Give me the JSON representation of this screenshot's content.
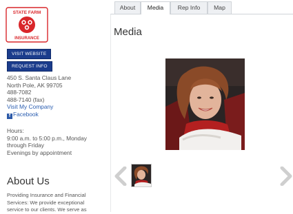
{
  "sidebar": {
    "logo": {
      "top_text": "STATE FARM",
      "bottom_text": "INSURANCE"
    },
    "buttons": {
      "visit_website": "VISIT WEBSITE",
      "request_info": "REQUEST INFO"
    },
    "address_line1": "450 S. Santa Claus Lane",
    "address_line2": "North Pole, AK 99705",
    "phone": "488-7082",
    "fax": "488-7140 (fax)",
    "visit_company": "Visit My Company",
    "facebook": "Facebook",
    "hours_label": "Hours:",
    "hours_line1": "9:00 a.m. to 5:00 p.m., Monday",
    "hours_line2": "through Friday",
    "hours_line3": "Evenings by appointment",
    "about_title": "About Us",
    "about_line1": "Providing Insurance and Financial",
    "about_line2": "Services: We provide exceptional",
    "about_line3": "service to our clients. We serve as"
  },
  "tabs": [
    {
      "label": "About"
    },
    {
      "label": "Media"
    },
    {
      "label": "Rep Info"
    },
    {
      "label": "Map"
    }
  ],
  "main": {
    "title": "Media"
  },
  "colors": {
    "brand_red": "#d9262a",
    "button_blue": "#1b3c8c",
    "link_blue": "#2a5db0"
  },
  "icons": {
    "prev": "chevron-left-icon",
    "next": "chevron-right-icon",
    "facebook": "facebook-icon"
  }
}
